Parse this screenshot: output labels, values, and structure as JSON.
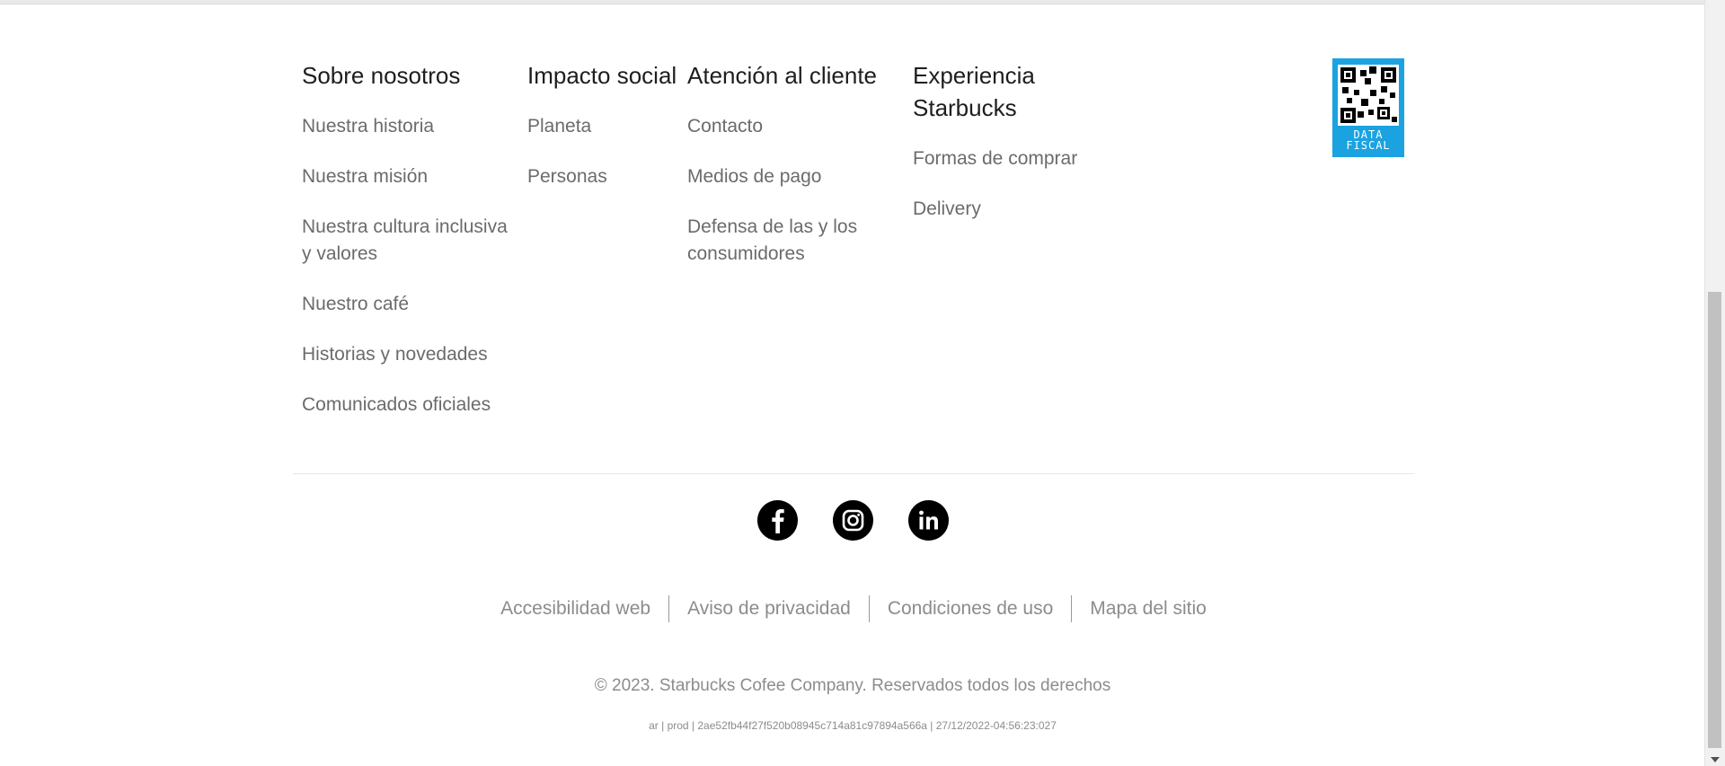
{
  "footer": {
    "columns": [
      {
        "title": "Sobre nosotros",
        "links": [
          "Nuestra historia",
          "Nuestra misión",
          "Nuestra cultura inclusiva y valores",
          "Nuestro café",
          "Historias y novedades",
          "Comunicados oficiales"
        ]
      },
      {
        "title": "Impacto social",
        "links": [
          "Planeta",
          "Personas"
        ]
      },
      {
        "title": "Atención al cliente",
        "links": [
          "Contacto",
          "Medios de pago",
          "Defensa de las y los consumidores"
        ]
      },
      {
        "title": "Experiencia Starbucks",
        "links": [
          "Formas de comprar",
          "Delivery"
        ]
      }
    ],
    "data_fiscal": {
      "caption_line1": "DATA",
      "caption_line2": "FISCAL",
      "color": "#1aa3e0"
    },
    "social": [
      {
        "name": "facebook-icon"
      },
      {
        "name": "instagram-icon"
      },
      {
        "name": "linkedin-icon"
      }
    ],
    "legal_links": [
      "Accesibilidad web",
      "Aviso de privacidad",
      "Condiciones de uso",
      "Mapa del sitio"
    ],
    "copyright": "© 2023. Starbucks Cofee Company. Reservados todos los derechos",
    "build_info": "ar | prod | 2ae52fb44f27f520b08945c714a81c97894a566a | 27/12/2022-04:56:23:027"
  }
}
